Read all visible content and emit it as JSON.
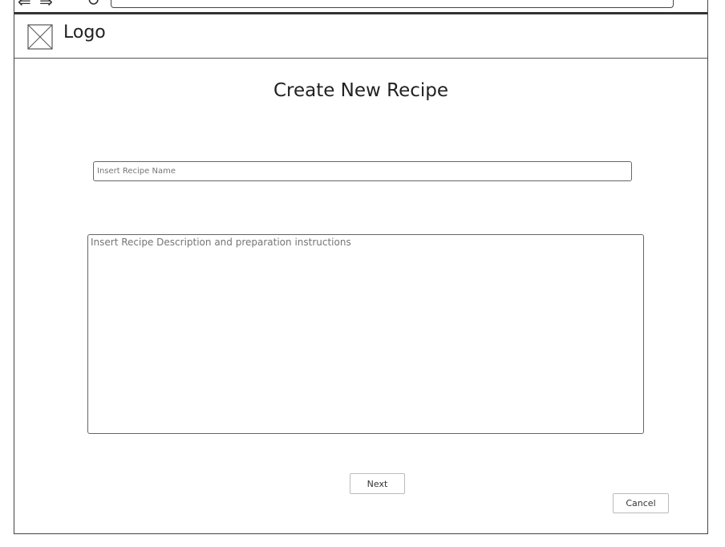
{
  "browser": {
    "nav_arrows": "⇐ ⇒",
    "reload_icon": "reload-icon"
  },
  "header": {
    "logo_label": "Logo"
  },
  "form": {
    "title": "Create New Recipe",
    "name_placeholder": "Insert Recipe Name",
    "description_placeholder": "Insert Recipe Description and preparation instructions",
    "next_label": "Next",
    "cancel_label": "Cancel"
  }
}
